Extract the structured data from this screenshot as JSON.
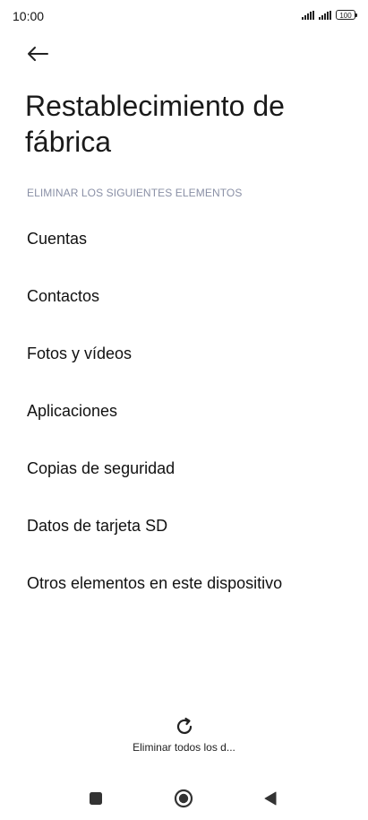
{
  "status_bar": {
    "time": "10:00",
    "battery": "100"
  },
  "header": {
    "title": "Restablecimiento de fábrica"
  },
  "section": {
    "header": "ELIMINAR LOS SIGUIENTES ELEMENTOS",
    "items": [
      {
        "label": "Cuentas"
      },
      {
        "label": "Contactos"
      },
      {
        "label": "Fotos y vídeos"
      },
      {
        "label": "Aplicaciones"
      },
      {
        "label": "Copias de seguridad"
      },
      {
        "label": "Datos de tarjeta SD"
      },
      {
        "label": "Otros elementos en este dispositivo"
      }
    ]
  },
  "footer": {
    "reset_label": "Eliminar todos los d..."
  },
  "icons": {
    "back": "back-arrow-icon",
    "reset": "refresh-icon",
    "recents": "square-icon",
    "home": "circle-icon",
    "back_nav": "triangle-icon"
  }
}
